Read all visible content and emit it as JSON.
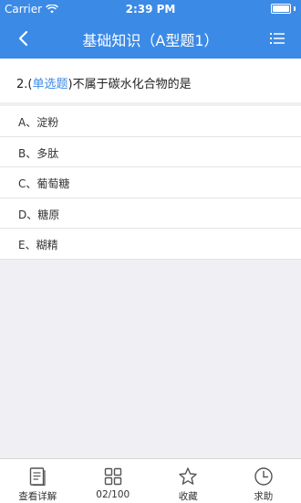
{
  "status_bar": {
    "carrier": "Carrier",
    "time": "2:39 PM"
  },
  "navbar": {
    "title": "基础知识（A型题1）"
  },
  "question": {
    "number": "2.(",
    "type": "单选题",
    "close": ")",
    "text": "不属于碳水化合物的是"
  },
  "options": [
    {
      "label": "A、淀粉"
    },
    {
      "label": "B、多肽"
    },
    {
      "label": "C、葡萄糖"
    },
    {
      "label": "D、糖原"
    },
    {
      "label": "E、糊精"
    }
  ],
  "tabbar": {
    "items": [
      {
        "label": "查看详解",
        "icon": "document-icon"
      },
      {
        "label": "02/100",
        "icon": "grid-icon"
      },
      {
        "label": "收藏",
        "icon": "star-icon"
      },
      {
        "label": "求助",
        "icon": "clock-icon"
      }
    ]
  },
  "colors": {
    "primary": "#3b8ae6",
    "background": "#efeff4"
  }
}
